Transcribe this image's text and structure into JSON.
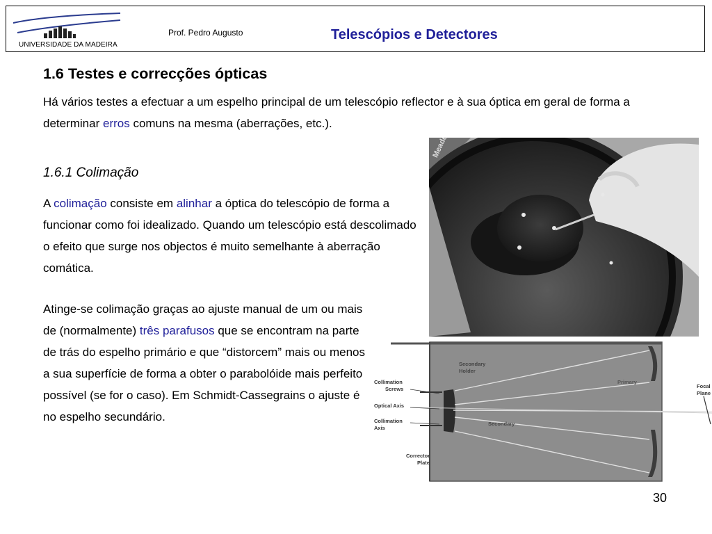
{
  "header": {
    "university": "UNIVERSIDADE DA MADEIRA",
    "author": "Prof. Pedro Augusto",
    "course_title": "Telescópios e Detectores"
  },
  "section": {
    "title": "1.6 Testes e correcções ópticas",
    "intro_part1": "Há vários testes a efectuar a um espelho principal de um telescópio reflector e à sua óptica em geral de forma a determinar ",
    "intro_link": "erros",
    "intro_part2": " comuns na mesma (aberrações, etc.)."
  },
  "subsection": {
    "title": "1.6.1 Colimação",
    "p1_a": "A ",
    "p1_link1": "colimação",
    "p1_b": " consiste em ",
    "p1_link2": "alinhar",
    "p1_c": " a óptica do telescópio de forma a funcionar como foi idealizado. Quando um telescópio está descolimado o efeito que surge nos objectos é muito semelhante à aberração comática.",
    "p2_a": "Atinge-se colimação graças ao ajuste manual de um ou mais de (normalmente) ",
    "p2_link": "três parafusos",
    "p2_b": " que se encontram na parte de trás do espelho primário e que “distorcem” mais ou menos a sua superfície de forma a obter o parabolóide mais perfeito possível (se for o caso). Em Schmidt-Cassegrains o ajuste é no espelho secundário."
  },
  "photo": {
    "brand": "Meade"
  },
  "diagram": {
    "labels": {
      "secondary_holder_1": "Secondary",
      "secondary_holder_2": "Holder",
      "primary": "Primary",
      "collimation_screws_1": "Collimation",
      "collimation_screws_2": "Screws",
      "optical_axis": "Optical Axis",
      "collimation_axis_1": "Collimation",
      "collimation_axis_2": "Axis",
      "secondary": "Secondary",
      "corrector_plate_1": "Corrector",
      "corrector_plate_2": "Plate",
      "focal_plane_1": "Focal",
      "focal_plane_2": "Plane"
    }
  },
  "page_number": "30",
  "colors": {
    "accent": "#1f1f99",
    "logo_blue": "#2b3c8f"
  }
}
